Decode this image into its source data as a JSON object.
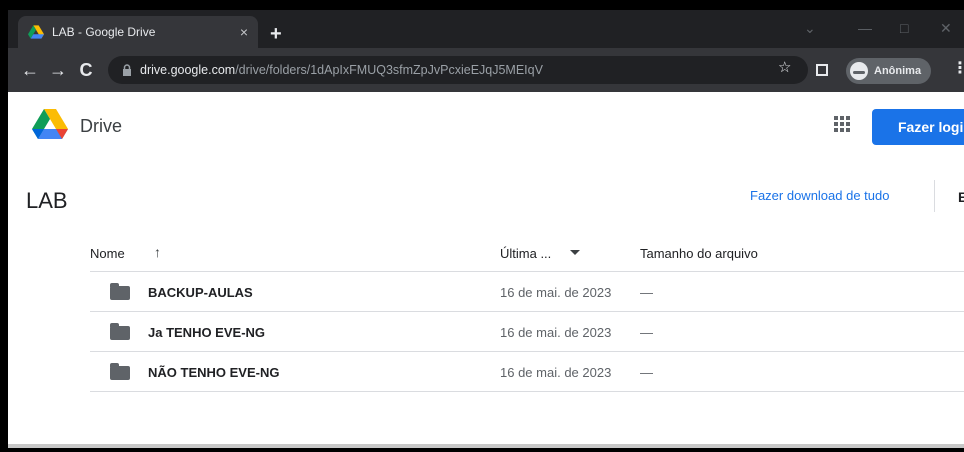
{
  "browser": {
    "tab_title": "LAB - Google Drive",
    "tab_close": "×",
    "new_tab": "+",
    "url_host": "drive.google.com",
    "url_path": "/drive/folders/1dApIxFMUQ3sfmZpJvPcxieEJqJ5MEIqV",
    "profile_label": "Anônima"
  },
  "drive": {
    "app_name": "Drive",
    "login_label": "Fazer login",
    "folder_title": "LAB",
    "download_all_label": "Fazer download de tudo",
    "clipped_letter": "E"
  },
  "table": {
    "col_name": "Nome",
    "col_modified": "Última ...",
    "col_size": "Tamanho do arquivo",
    "rows": [
      {
        "name": "BACKUP-AULAS",
        "modified": "16 de mai. de 2023",
        "size": "—"
      },
      {
        "name": "Ja TENHO EVE-NG",
        "modified": "16 de mai. de 2023",
        "size": "—"
      },
      {
        "name": "NÃO TENHO EVE-NG",
        "modified": "16 de mai. de 2023",
        "size": "—"
      }
    ]
  },
  "colors": {
    "accent": "#1a73e8",
    "chrome_dark": "#202124",
    "chrome_toolbar": "#35363a"
  }
}
